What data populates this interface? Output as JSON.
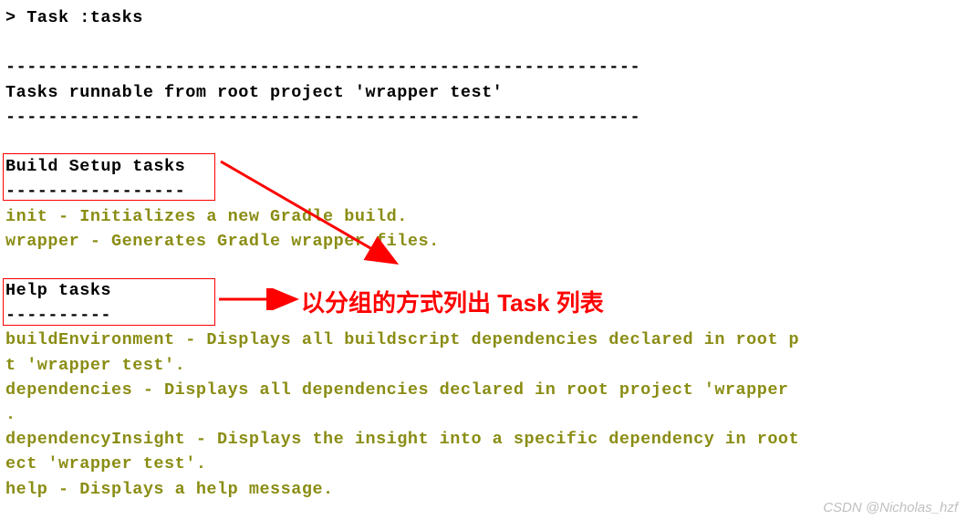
{
  "header": {
    "command": "> Task :tasks",
    "title": "Tasks runnable from root project 'wrapper test'"
  },
  "separator_long": "------------------------------------------------------------",
  "sections": [
    {
      "name": "Build Setup tasks",
      "underline": "-----------------",
      "tasks": [
        "init - Initializes a new Gradle build.",
        "wrapper - Generates Gradle wrapper files."
      ]
    },
    {
      "name": "Help tasks",
      "underline": "----------",
      "tasks": [
        "buildEnvironment - Displays all buildscript dependencies declared in root p",
        "t 'wrapper test'."
      ]
    }
  ],
  "extra_lines": [
    "dependencies - Displays all dependencies declared in root project 'wrapper ",
    ".",
    "dependencyInsight - Displays the insight into a specific dependency in root",
    "ect 'wrapper test'.",
    "help - Displays a help message."
  ],
  "annotation": {
    "text": "以分组的方式列出 Task 列表"
  },
  "watermark": "CSDN @Nicholas_hzf",
  "colors": {
    "accent_red": "#ff0000",
    "olive": "#8a8d14",
    "text": "#000000"
  }
}
